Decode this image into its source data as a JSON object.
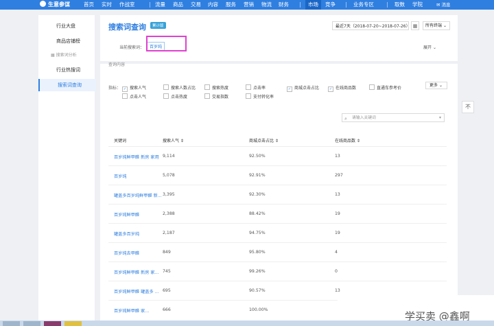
{
  "topbar": {
    "brand": "生意参谋",
    "nav": [
      "首页",
      "实时",
      "作战室",
      "流量",
      "商品",
      "交易",
      "内容",
      "服务",
      "营销",
      "物流",
      "财务",
      "市场",
      "竞争",
      "业务专区",
      "取数",
      "学院"
    ],
    "active_nav": "市场",
    "message": "消息"
  },
  "sidebar": {
    "items": [
      "行业大盘",
      "商品店铺榜",
      "行业热搜词",
      "搜索词查询"
    ],
    "group": "搜索词分析",
    "active": "搜索词查询"
  },
  "header": {
    "title": "搜索词查询",
    "badge": "累计版",
    "date_range": "最近7天（2018-07-20~2018-07-26）",
    "terminal": "所有终端",
    "current_label": "当前搜索词：",
    "current_term": "百岁纯",
    "expand": "展开"
  },
  "panel": {
    "section_title": "查询内容",
    "indicator_label": "指标：",
    "indicators": [
      {
        "label": "搜索人气",
        "checked": true
      },
      {
        "label": "搜索人数占比",
        "checked": false
      },
      {
        "label": "搜索热度",
        "checked": false
      },
      {
        "label": "点击率",
        "checked": false
      },
      {
        "label": "商城点击占比",
        "checked": true
      },
      {
        "label": "在线商品数",
        "checked": true
      },
      {
        "label": "直通车参考价",
        "checked": false
      },
      {
        "label": "点击人气",
        "checked": false
      },
      {
        "label": "点击热度",
        "checked": false
      },
      {
        "label": "交易指数",
        "checked": false
      },
      {
        "label": "支付转化率",
        "checked": false
      }
    ],
    "more": "更多",
    "search_placeholder": "请输入关键词"
  },
  "table": {
    "headers": [
      "关键词",
      "搜索人气 ⇕",
      "商城点击占比 ⇕",
      "在线商品数 ⇕"
    ],
    "rows": [
      [
        "百岁纯鲜甲醛 新房 家用",
        "9,114",
        "92.50%",
        "13"
      ],
      [
        "百岁纯",
        "5,078",
        "92.91%",
        "297"
      ],
      [
        "罐盖多百岁纯鲜甲醛 新...",
        "3,395",
        "92.30%",
        "13"
      ],
      [
        "百岁纯鲜甲醛",
        "2,388",
        "88.42%",
        "19"
      ],
      [
        "罐盖多百岁纯",
        "2,187",
        "94.75%",
        "19"
      ],
      [
        "百岁纯去甲醛",
        "849",
        "95.80%",
        "4"
      ],
      [
        "百岁纯鲜甲醛 新房 家...",
        "745",
        "99.26%",
        "0"
      ],
      [
        "百岁纯鲜甲醛 罐盖多 ...",
        "695",
        "90.57%",
        "13"
      ],
      [
        "百岁纯鲜甲醛 家...",
        "666",
        "100.00%",
        ""
      ]
    ]
  },
  "float_button": "不",
  "watermark": "学买卖 @鑫啊"
}
